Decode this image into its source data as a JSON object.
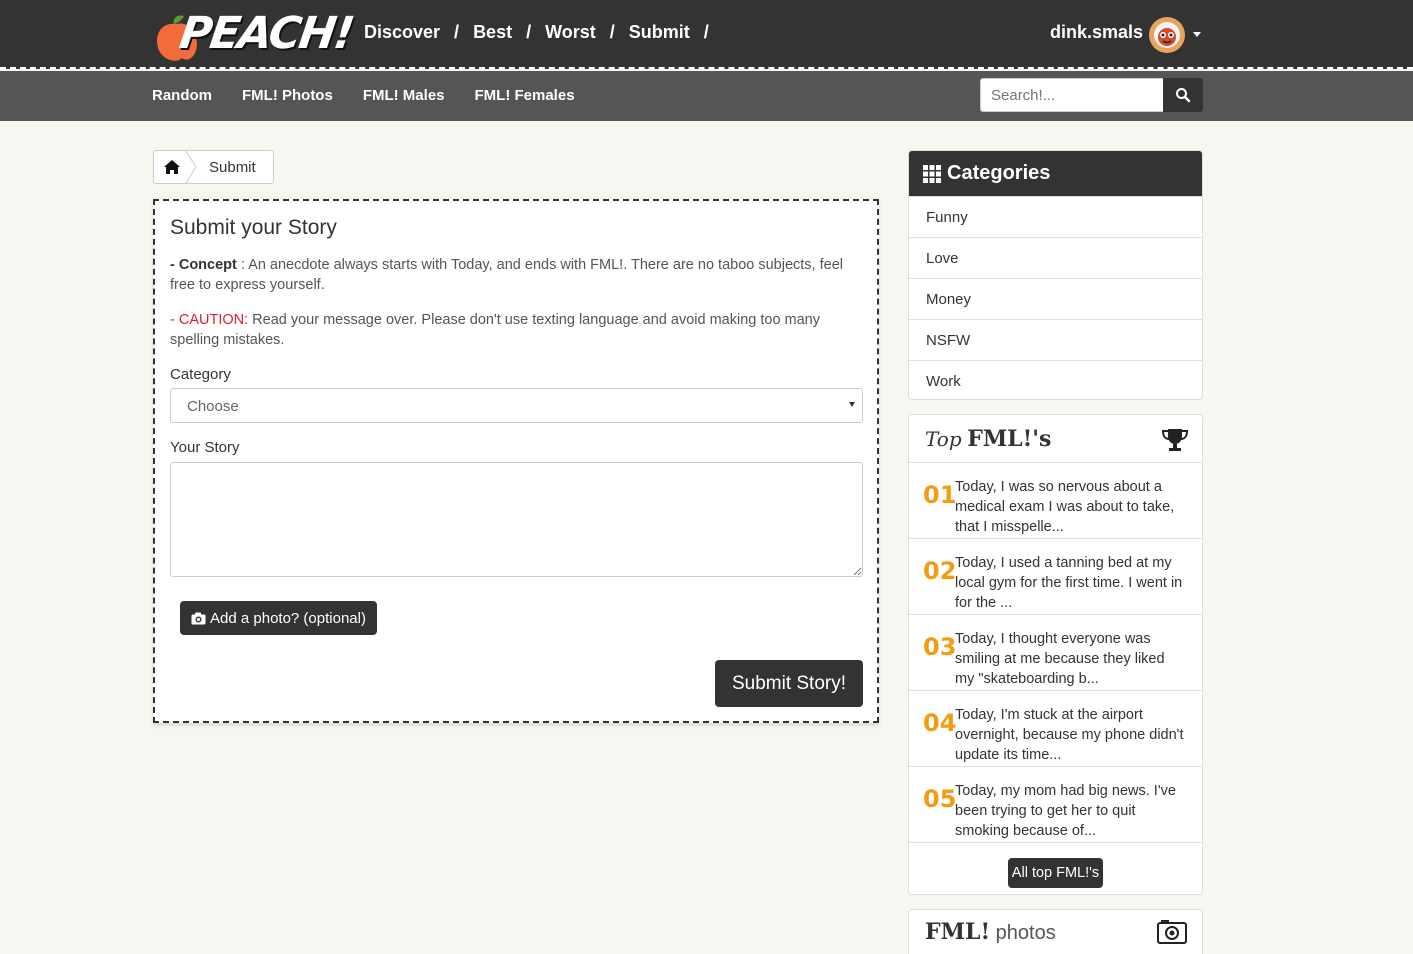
{
  "header": {
    "logo_text": "PEACH!",
    "nav": [
      {
        "label": "Discover"
      },
      {
        "label": "Best"
      },
      {
        "label": "Worst"
      },
      {
        "label": "Submit"
      }
    ],
    "nav_separator": "/",
    "username": "dink.smals",
    "avatar_icon": "user-avatar-icon"
  },
  "subnav": {
    "items": [
      {
        "label": "Random"
      },
      {
        "label": "FML! Photos"
      },
      {
        "label": "FML! Males"
      },
      {
        "label": "FML! Females"
      }
    ],
    "search_placeholder": "Search!..."
  },
  "breadcrumb": {
    "home_icon": "home-icon",
    "current": "Submit"
  },
  "submit_form": {
    "title": "Submit your Story",
    "concept_label": "- Concept",
    "concept_text": " : An anecdote always starts with Today, and ends with FML!. There are no taboo subjects, feel free to express yourself.",
    "caution_label": "- CAUTION:",
    "caution_text": " Read your message over. Please don't use texting language and avoid making too many spelling mistakes.",
    "category_label": "Category",
    "category_value": "Choose",
    "story_label": "Your Story",
    "story_value": "",
    "photo_button": "Add a photo? (optional)",
    "submit_button": "Submit Story!"
  },
  "categories": {
    "title": "Categories",
    "items": [
      "Funny",
      "Love",
      "Money",
      "NSFW",
      "Work"
    ]
  },
  "top_fml": {
    "title_prefix": "Top",
    "title_main": "FML!'s",
    "items": [
      {
        "rank": "01",
        "text": "Today, I was so nervous about a medical exam I was about to take, that I misspelle..."
      },
      {
        "rank": "02",
        "text": "Today, I used a tanning bed at my local gym for the first time. I went in for the ..."
      },
      {
        "rank": "03",
        "text": "Today, I thought everyone was smiling at me because they liked my \"skateboarding b..."
      },
      {
        "rank": "04",
        "text": "Today, I'm stuck at the airport overnight, because my phone didn't update its time..."
      },
      {
        "rank": "05",
        "text": "Today, my mom had big news. I've been trying to get her to quit smoking because of..."
      }
    ],
    "all_button": "All top FML!'s"
  },
  "photos_panel": {
    "title_main": "FML!",
    "title_sub": "photos"
  },
  "colors": {
    "header_bg": "#333333",
    "subbar_bg": "#555555",
    "accent_orange": "#f39c12",
    "caution_red": "#d9232d",
    "page_bg": "#f7f7f2"
  }
}
